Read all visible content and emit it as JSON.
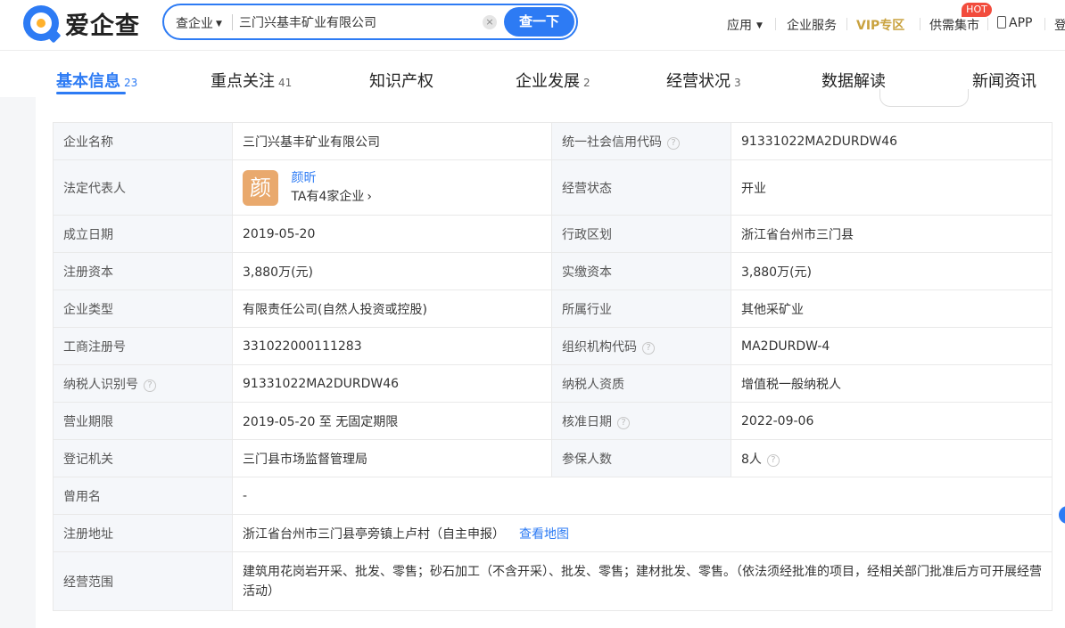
{
  "header": {
    "logo_text": "爱企查",
    "search_type": "查企业",
    "search_value": "三门兴基丰矿业有限公司",
    "search_button": "查一下",
    "nav": [
      "应用",
      "企业服务",
      "VIP专区",
      "供需集市",
      "APP",
      "登"
    ],
    "hot_badge": "HOT"
  },
  "tabs": [
    {
      "label": "基本信息",
      "count": "23"
    },
    {
      "label": "重点关注",
      "count": "41"
    },
    {
      "label": "知识产权",
      "count": ""
    },
    {
      "label": "企业发展",
      "count": "2"
    },
    {
      "label": "经营状况",
      "count": "3"
    },
    {
      "label": "数据解读",
      "count": ""
    },
    {
      "label": "新闻资讯",
      "count": ""
    }
  ],
  "info": {
    "company_name_k": "企业名称",
    "company_name_v": "三门兴基丰矿业有限公司",
    "credit_code_k": "统一社会信用代码",
    "credit_code_v": "91331022MA2DURDW46",
    "legal_rep_k": "法定代表人",
    "legal_rep_avatar": "颜",
    "legal_rep_name": "颜昕",
    "legal_rep_sub": "TA有4家企业",
    "status_k": "经营状态",
    "status_v": "开业",
    "found_date_k": "成立日期",
    "found_date_v": "2019-05-20",
    "region_k": "行政区划",
    "region_v": "浙江省台州市三门县",
    "reg_capital_k": "注册资本",
    "reg_capital_v": "3,880万(元)",
    "paid_capital_k": "实缴资本",
    "paid_capital_v": "3,880万(元)",
    "type_k": "企业类型",
    "type_v": "有限责任公司(自然人投资或控股)",
    "industry_k": "所属行业",
    "industry_v": "其他采矿业",
    "reg_no_k": "工商注册号",
    "reg_no_v": "331022000111283",
    "org_code_k": "组织机构代码",
    "org_code_v": "MA2DURDW-4",
    "tax_id_k": "纳税人识别号",
    "tax_id_v": "91331022MA2DURDW46",
    "tax_qual_k": "纳税人资质",
    "tax_qual_v": "增值税一般纳税人",
    "term_k": "营业期限",
    "term_v": "2019-05-20 至 无固定期限",
    "approve_date_k": "核准日期",
    "approve_date_v": "2022-09-06",
    "authority_k": "登记机关",
    "authority_v": "三门县市场监督管理局",
    "insured_k": "参保人数",
    "insured_v": "8人",
    "former_name_k": "曾用名",
    "former_name_v": "-",
    "address_k": "注册地址",
    "address_v": "浙江省台州市三门县亭旁镇上卢村（自主申报）",
    "map_link": "查看地图",
    "scope_k": "经营范围",
    "scope_v": "建筑用花岗岩开采、批发、零售；砂石加工（不含开采）、批发、零售；建材批发、零售。（依法须经批准的项目，经相关部门批准后方可开展经营活动）"
  }
}
